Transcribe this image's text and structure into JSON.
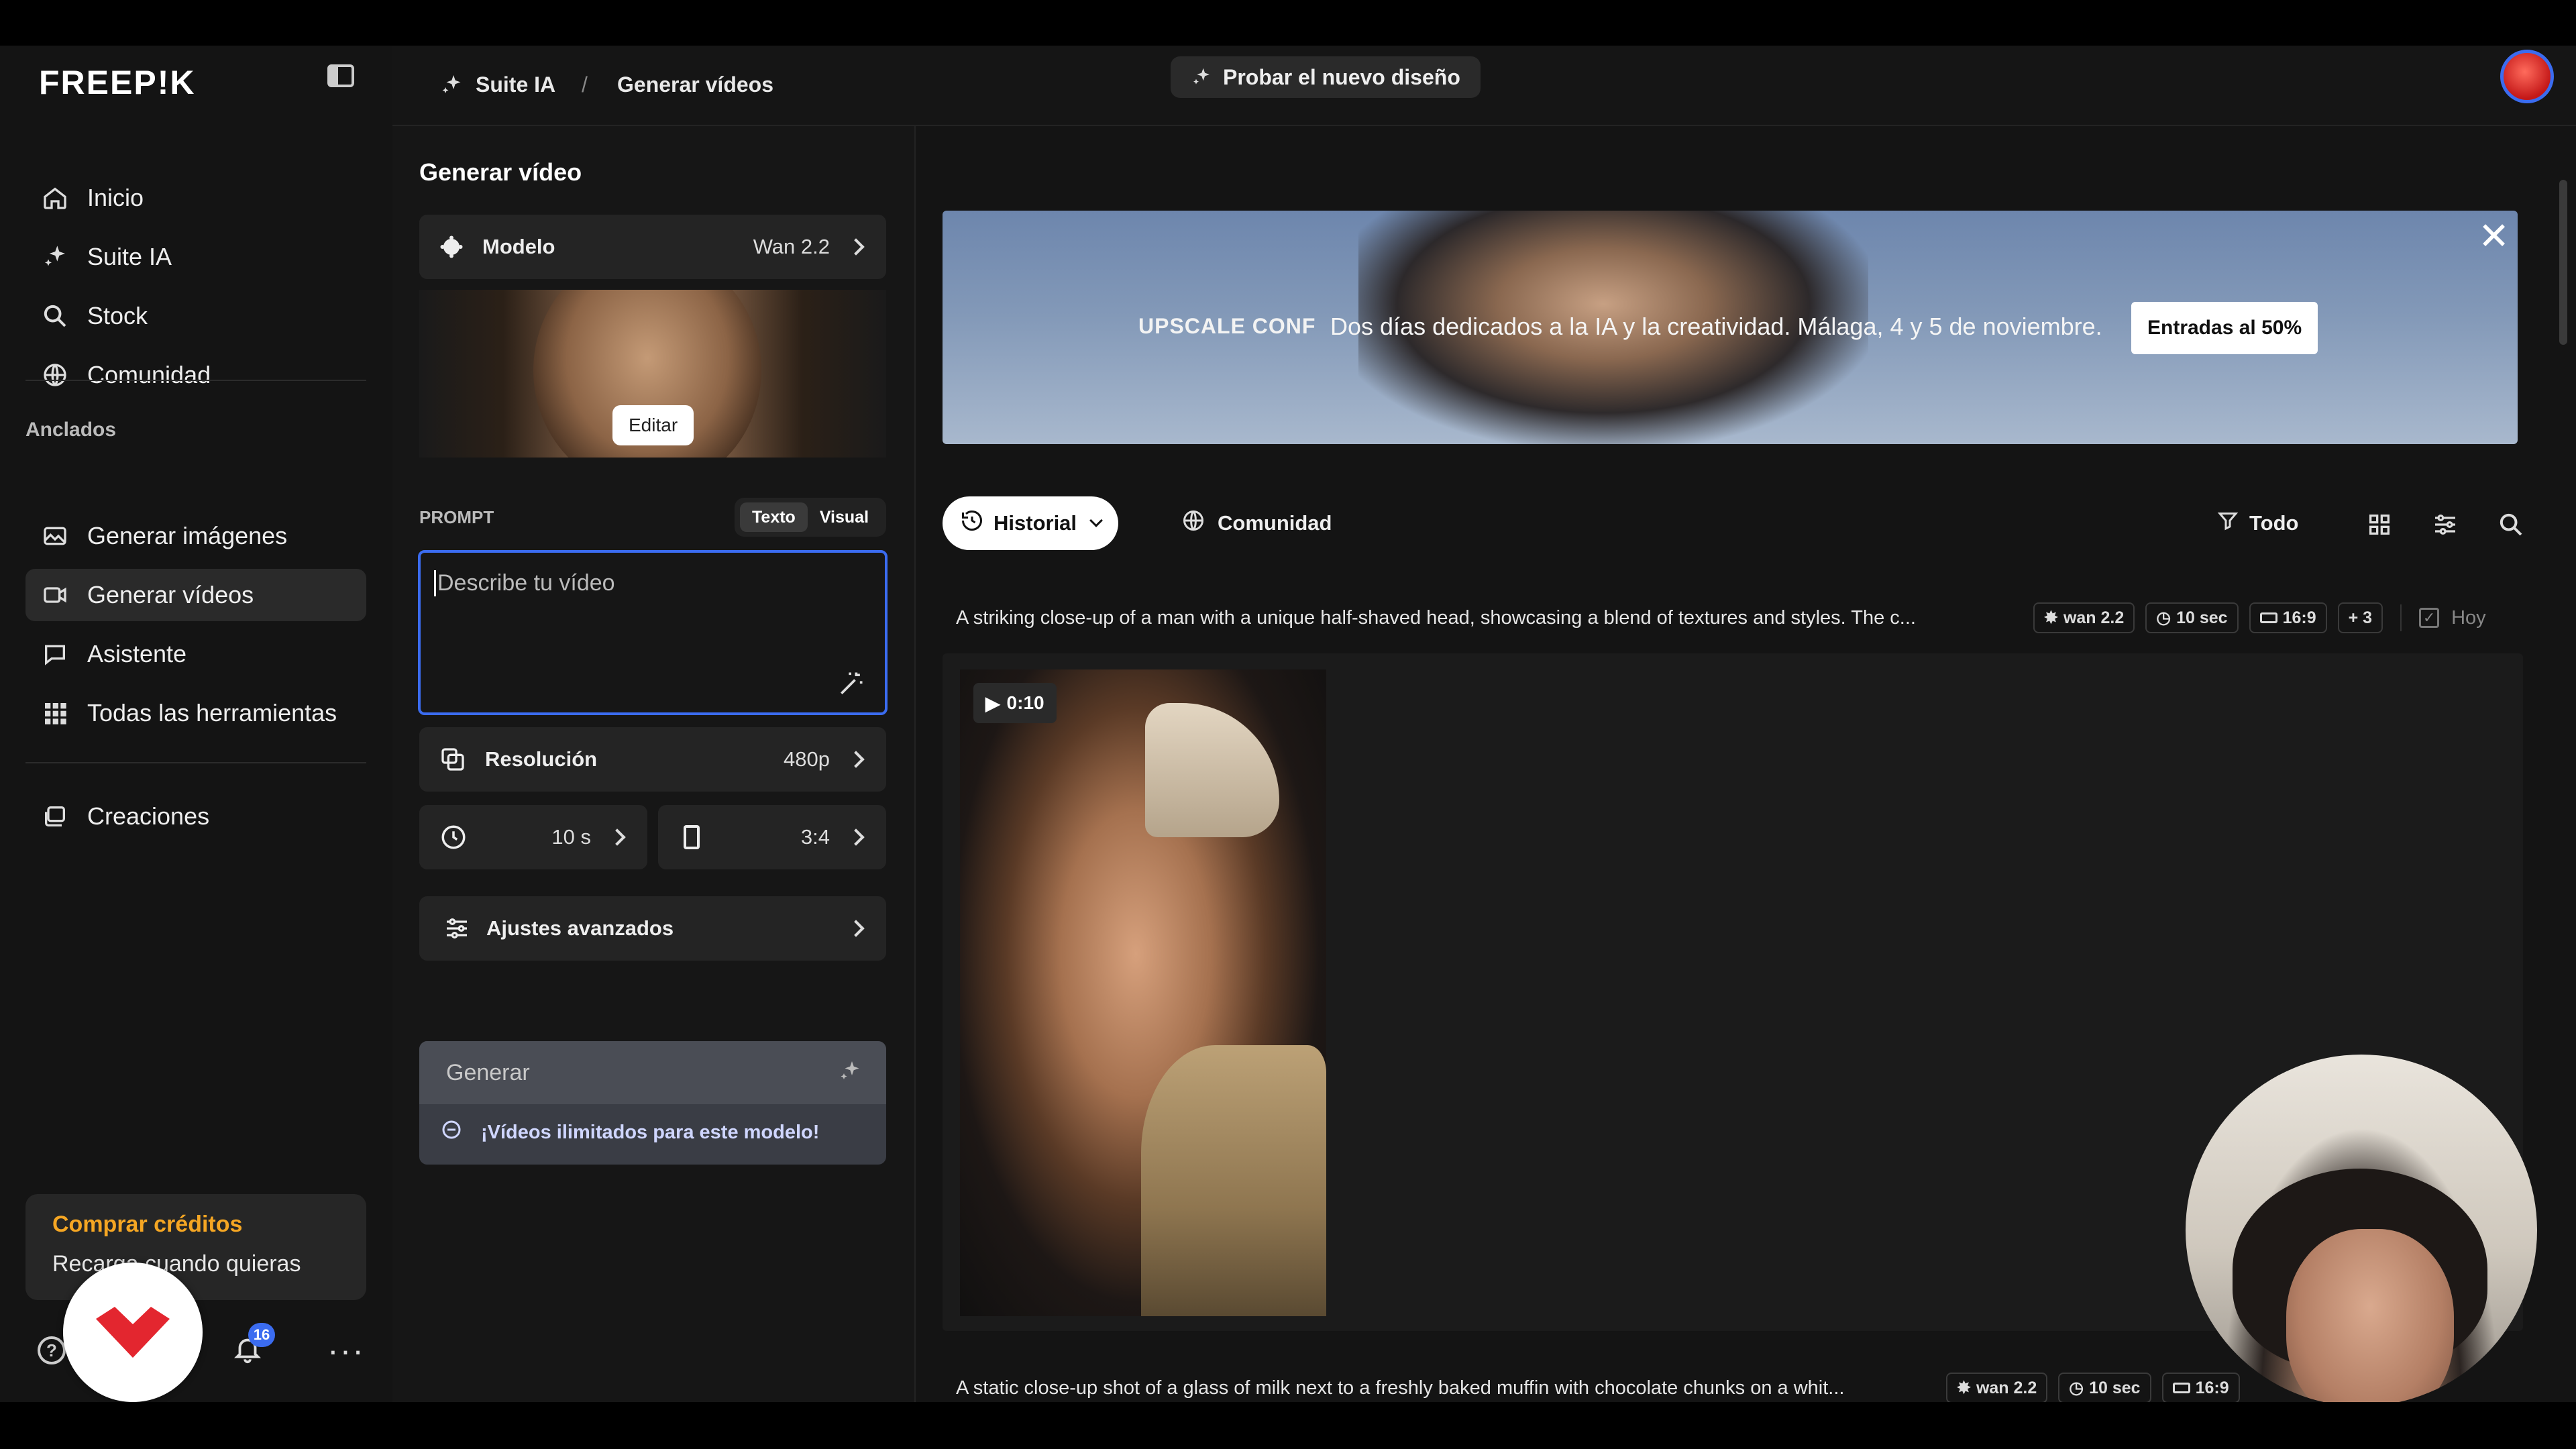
{
  "app": {
    "logo": "FREEP!K"
  },
  "sidebar": {
    "nav": [
      {
        "label": "Inicio",
        "icon": "home-icon"
      },
      {
        "label": "Suite IA",
        "icon": "sparkle-icon"
      },
      {
        "label": "Stock",
        "icon": "search-icon"
      },
      {
        "label": "Comunidad",
        "icon": "globe-icon"
      }
    ],
    "pinned_title": "Anclados",
    "pinned": [
      {
        "label": "Generar imágenes",
        "icon": "image-icon"
      },
      {
        "label": "Generar vídeos",
        "icon": "video-icon"
      },
      {
        "label": "Asistente",
        "icon": "assistant-icon"
      },
      {
        "label": "Todas las herramientas",
        "icon": "grid-icon"
      }
    ],
    "creations": {
      "label": "Creaciones",
      "icon": "creations-icon"
    },
    "credits": {
      "title": "Comprar créditos",
      "subtitle": "Recarga cuando quieras"
    },
    "notifications_count": "16"
  },
  "topbar": {
    "crumb1": "Suite IA",
    "separator": "/",
    "crumb2": "Generar vídeos",
    "try_new": "Probar el nuevo diseño"
  },
  "panel": {
    "title": "Generar vídeo",
    "model_label": "Modelo",
    "model_value": "Wan 2.2",
    "edit_label": "Editar",
    "prompt_label": "PROMPT",
    "prompt_tab_text": "Texto",
    "prompt_tab_visual": "Visual",
    "prompt_placeholder": "Describe tu vídeo",
    "resolution_label": "Resolución",
    "resolution_value": "480p",
    "duration_value": "10 s",
    "ratio_value": "3:4",
    "advanced_label": "Ajustes avanzados",
    "generate_label": "Generar",
    "unlimited_note": "¡Vídeos ilimitados para este modelo!"
  },
  "banner": {
    "brand": "UPSCALE CONF",
    "text": "Dos días dedicados a la IA y la creatividad. Málaga, 4 y 5 de noviembre.",
    "cta": "Entradas al 50%"
  },
  "feed": {
    "tab_history": "Historial",
    "tab_community": "Comunidad",
    "filter_all": "Todo",
    "items": [
      {
        "prompt": "A striking close-up of a man with a unique half-shaved head, showcasing a blend of textures and styles. The c...",
        "model": "wan 2.2",
        "duration": "10 sec",
        "ratio": "16:9",
        "more": "+ 3",
        "date": "Hoy",
        "video_duration": "0:10"
      },
      {
        "prompt": "A static close-up shot of a glass of milk next to a freshly baked muffin with chocolate chunks on a whit...",
        "model": "wan 2.2",
        "duration": "10 sec",
        "ratio": "16:9"
      }
    ]
  },
  "colors": {
    "accent": "#3b6cf0",
    "credits": "#f5a623",
    "brand_red": "#e3262f"
  }
}
